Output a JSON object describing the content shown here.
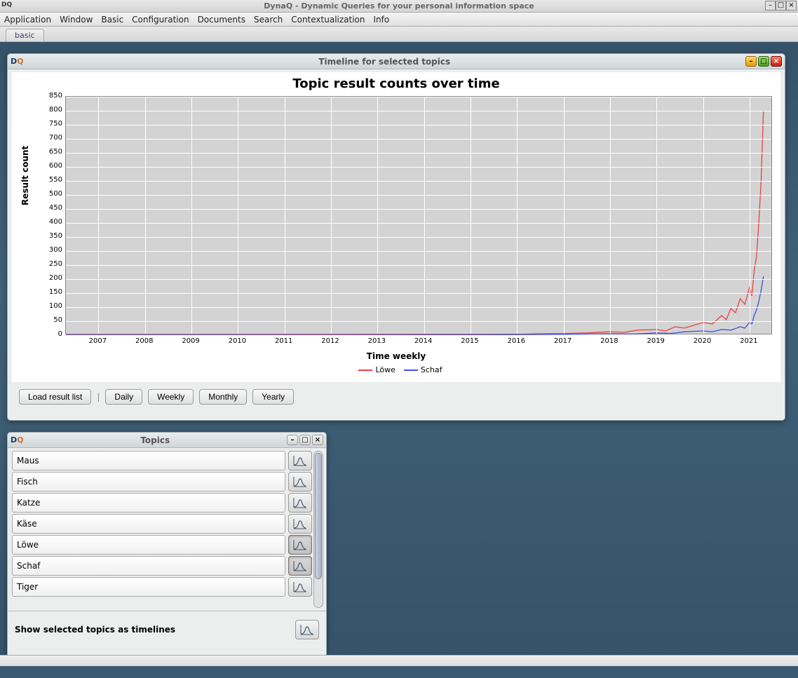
{
  "app": {
    "title": "DynaQ - Dynamic Queries for your personal information space"
  },
  "menubar": [
    "Application",
    "Window",
    "Basic",
    "Configuration",
    "Documents",
    "Search",
    "Contextualization",
    "Info"
  ],
  "tabs": [
    {
      "label": "basic"
    }
  ],
  "timeline": {
    "title": "Timeline for selected topics",
    "buttons": {
      "load": "Load result list",
      "daily": "Daily",
      "weekly": "Weekly",
      "monthly": "Monthly",
      "yearly": "Yearly"
    }
  },
  "chart_data": {
    "type": "line",
    "title": "Topic result counts over time",
    "xlabel": "Time weekly",
    "ylabel": "Result count",
    "ylim": [
      0,
      850
    ],
    "yticks": [
      0,
      50,
      100,
      150,
      200,
      250,
      300,
      350,
      400,
      450,
      500,
      550,
      600,
      650,
      700,
      750,
      800,
      850
    ],
    "xticks": [
      2007,
      2008,
      2009,
      2010,
      2011,
      2012,
      2013,
      2014,
      2015,
      2016,
      2017,
      2018,
      2019,
      2020,
      2021
    ],
    "xrange": [
      2006.3,
      2021.5
    ],
    "series": [
      {
        "name": "Löwe",
        "color": "#ee4040",
        "points": [
          [
            2006.3,
            1
          ],
          [
            2010,
            1
          ],
          [
            2013,
            2
          ],
          [
            2014,
            2
          ],
          [
            2015,
            2
          ],
          [
            2016,
            3
          ],
          [
            2016.5,
            5
          ],
          [
            2017,
            6
          ],
          [
            2017.5,
            8
          ],
          [
            2018,
            12
          ],
          [
            2018.3,
            10
          ],
          [
            2018.6,
            18
          ],
          [
            2019,
            20
          ],
          [
            2019.2,
            15
          ],
          [
            2019.4,
            30
          ],
          [
            2019.6,
            25
          ],
          [
            2019.8,
            35
          ],
          [
            2020,
            45
          ],
          [
            2020.2,
            40
          ],
          [
            2020.4,
            70
          ],
          [
            2020.5,
            55
          ],
          [
            2020.6,
            95
          ],
          [
            2020.7,
            80
          ],
          [
            2020.8,
            130
          ],
          [
            2020.9,
            110
          ],
          [
            2021.0,
            170
          ],
          [
            2021.05,
            140
          ],
          [
            2021.1,
            230
          ],
          [
            2021.15,
            280
          ],
          [
            2021.2,
            400
          ],
          [
            2021.25,
            550
          ],
          [
            2021.3,
            800
          ]
        ]
      },
      {
        "name": "Schaf",
        "color": "#4050e0",
        "points": [
          [
            2006.3,
            0
          ],
          [
            2012,
            0
          ],
          [
            2015,
            1
          ],
          [
            2016,
            2
          ],
          [
            2017,
            3
          ],
          [
            2018,
            5
          ],
          [
            2018.5,
            4
          ],
          [
            2019,
            8
          ],
          [
            2019.3,
            6
          ],
          [
            2019.6,
            12
          ],
          [
            2020,
            15
          ],
          [
            2020.2,
            12
          ],
          [
            2020.4,
            20
          ],
          [
            2020.6,
            18
          ],
          [
            2020.8,
            30
          ],
          [
            2020.9,
            25
          ],
          [
            2021.0,
            45
          ],
          [
            2021.05,
            40
          ],
          [
            2021.1,
            70
          ],
          [
            2021.15,
            90
          ],
          [
            2021.2,
            120
          ],
          [
            2021.25,
            160
          ],
          [
            2021.3,
            210
          ]
        ]
      }
    ]
  },
  "topics": {
    "title": "Topics",
    "items": [
      {
        "name": "Maus",
        "active": false
      },
      {
        "name": "Fisch",
        "active": false
      },
      {
        "name": "Katze",
        "active": false
      },
      {
        "name": "Käse",
        "active": false
      },
      {
        "name": "Löwe",
        "active": true
      },
      {
        "name": "Schaf",
        "active": true
      },
      {
        "name": "Tiger",
        "active": false
      }
    ],
    "footer_label": "Show selected topics as timelines"
  }
}
